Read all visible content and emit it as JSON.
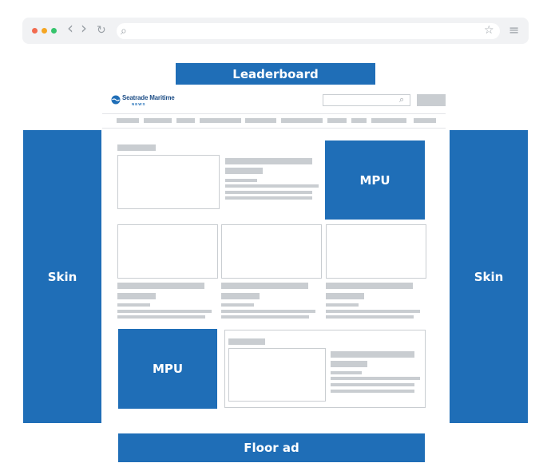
{
  "ads": {
    "leaderboard": "Leaderboard",
    "skin_left": "Skin",
    "skin_right": "Skin",
    "mpu_top": "MPU",
    "mpu_bottom": "MPU",
    "floor": "Floor ad"
  },
  "site": {
    "logo_text": "Seatrade Maritime",
    "logo_sub": "NEWS"
  },
  "colors": {
    "ad_blue": "#1f6eb7",
    "placeholder_gray": "#c9cdd1",
    "dot_red": "#f26b4f",
    "dot_yellow": "#f5a623",
    "dot_green": "#36c46c"
  },
  "icons": {
    "back": "‹",
    "forward": "›",
    "reload": "↻",
    "search": "⌕",
    "star": "☆",
    "menu": "≡"
  }
}
